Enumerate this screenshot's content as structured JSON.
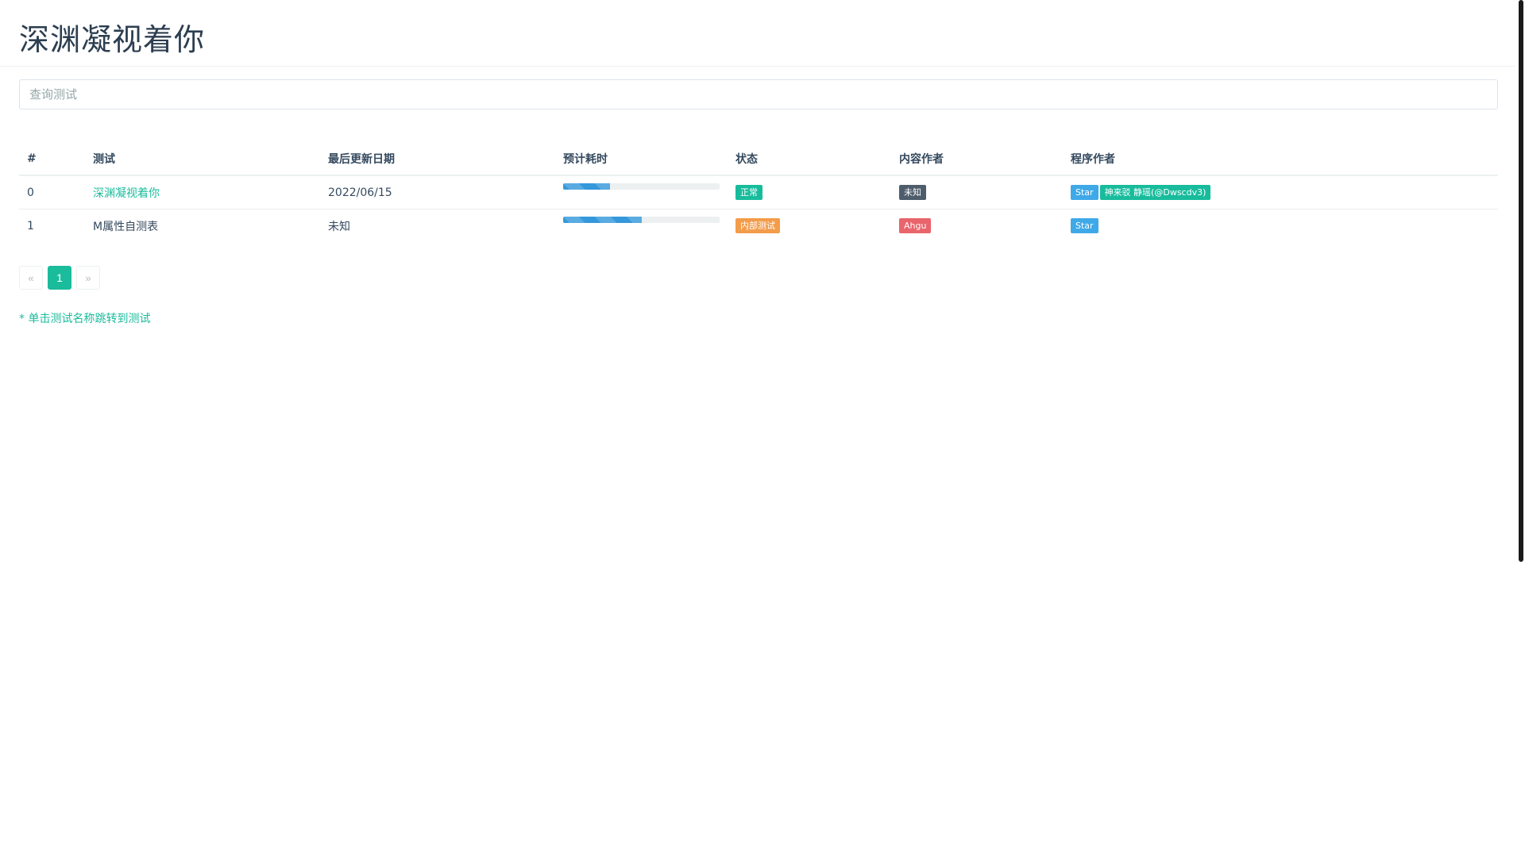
{
  "header": {
    "title": "深渊凝视着你"
  },
  "search": {
    "placeholder": "查询测试",
    "value": ""
  },
  "table": {
    "columns": [
      "#",
      "测试",
      "最后更新日期",
      "预计耗时",
      "状态",
      "内容作者",
      "程序作者"
    ],
    "rows": [
      {
        "index": "0",
        "name": "深渊凝视着你",
        "is_link": true,
        "date": "2022/06/15",
        "progress": 0.3,
        "status": {
          "label": "正常",
          "color": "#18bc9c"
        },
        "content_authors": [
          {
            "label": "未知",
            "color": "#4e5d6c"
          }
        ],
        "program_authors": [
          {
            "label": "Star",
            "color": "#3fa9e8"
          },
          {
            "label": "神来驳 静瑶(@Dwscdv3)",
            "color": "#18bc9c"
          }
        ]
      },
      {
        "index": "1",
        "name": "M属性自测表",
        "is_link": false,
        "date": "未知",
        "progress": 0.5,
        "status": {
          "label": "内部测试",
          "color": "#f39c4a"
        },
        "content_authors": [
          {
            "label": "Ahgu",
            "color": "#e9646b"
          }
        ],
        "program_authors": [
          {
            "label": "Star",
            "color": "#3fa9e8"
          }
        ]
      }
    ]
  },
  "pagination": {
    "prev_label": "«",
    "current_label": "1",
    "next_label": "»"
  },
  "hint": {
    "text": "* 单击测试名称跳转到测试"
  },
  "colors": {
    "accent": "#1abc9c",
    "progress": "#3498db"
  }
}
